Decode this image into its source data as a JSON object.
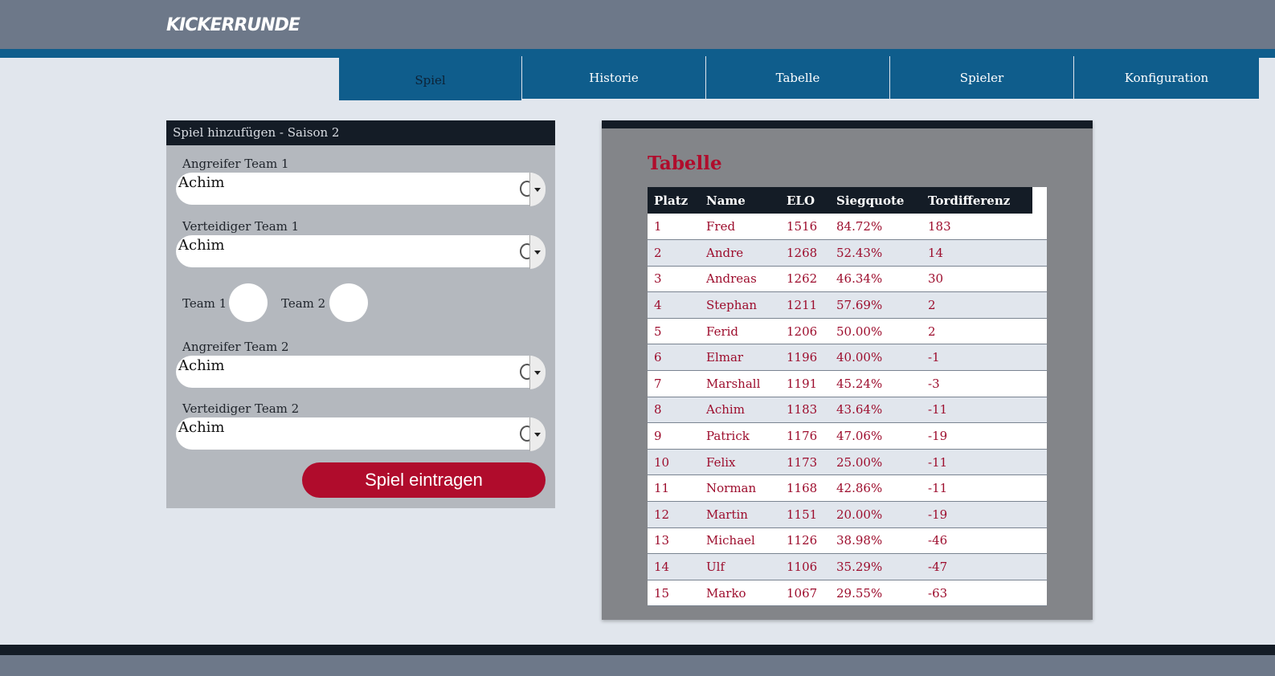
{
  "app": {
    "logo": "KICKERRUNDE"
  },
  "nav": {
    "items": [
      {
        "label": "Spiel",
        "active": true
      },
      {
        "label": "Historie",
        "active": false
      },
      {
        "label": "Tabelle",
        "active": false
      },
      {
        "label": "Spieler",
        "active": false
      },
      {
        "label": "Konfiguration",
        "active": false
      }
    ]
  },
  "form": {
    "header": "Spiel hinzufügen - Saison 2",
    "attacker1": {
      "label": "Angreifer Team 1",
      "value": "Achim"
    },
    "defender1": {
      "label": "Verteidiger Team 1",
      "value": "Achim"
    },
    "team1_label": "Team 1",
    "team2_label": "Team 2",
    "attacker2": {
      "label": "Angreifer Team 2",
      "value": "Achim"
    },
    "defender2": {
      "label": "Verteidiger Team 2",
      "value": "Achim"
    },
    "submit_label": "Spiel eintragen"
  },
  "table": {
    "title": "Tabelle",
    "headers": [
      "Platz",
      "Name",
      "ELO",
      "Siegquote",
      "Tordifferenz"
    ],
    "rows": [
      [
        "1",
        "Fred",
        "1516",
        "84.72%",
        "183"
      ],
      [
        "2",
        "Andre",
        "1268",
        "52.43%",
        "14"
      ],
      [
        "3",
        "Andreas",
        "1262",
        "46.34%",
        "30"
      ],
      [
        "4",
        "Stephan",
        "1211",
        "57.69%",
        "2"
      ],
      [
        "5",
        "Ferid",
        "1206",
        "50.00%",
        "2"
      ],
      [
        "6",
        "Elmar",
        "1196",
        "40.00%",
        "-1"
      ],
      [
        "7",
        "Marshall",
        "1191",
        "45.24%",
        "-3"
      ],
      [
        "8",
        "Achim",
        "1183",
        "43.64%",
        "-11"
      ],
      [
        "9",
        "Patrick",
        "1176",
        "47.06%",
        "-19"
      ],
      [
        "10",
        "Felix",
        "1173",
        "25.00%",
        "-11"
      ],
      [
        "11",
        "Norman",
        "1168",
        "42.86%",
        "-11"
      ],
      [
        "12",
        "Martin",
        "1151",
        "20.00%",
        "-19"
      ],
      [
        "13",
        "Michael",
        "1126",
        "38.98%",
        "-46"
      ],
      [
        "14",
        "Ulf",
        "1106",
        "35.29%",
        "-47"
      ],
      [
        "15",
        "Marko",
        "1067",
        "29.55%",
        "-63"
      ]
    ]
  },
  "colors": {
    "brand_blue": "#0f5d8c",
    "header_gray": "#6d7889",
    "dark": "#141c26",
    "accent_red": "#b00c2c"
  }
}
